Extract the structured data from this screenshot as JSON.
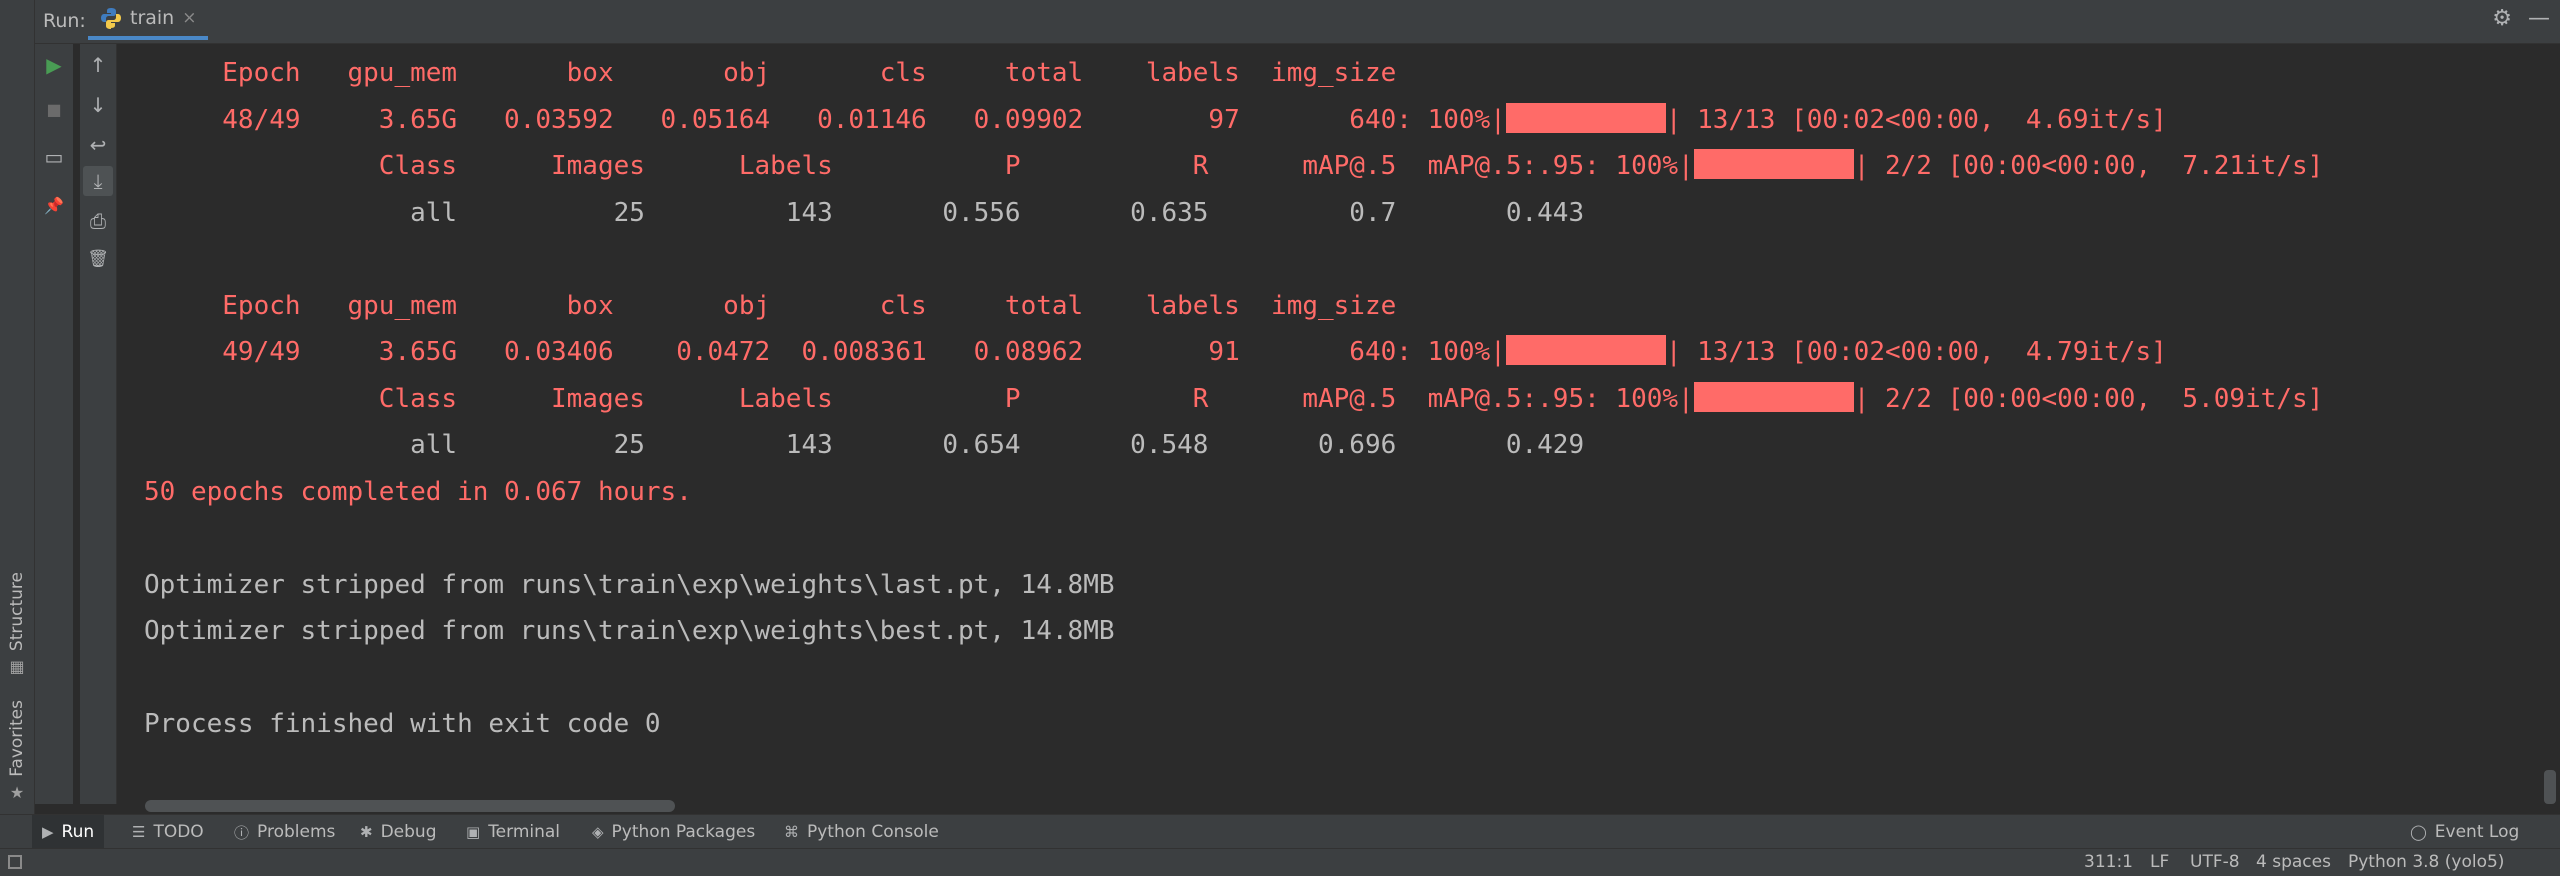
{
  "header": {
    "run_label": "Run:",
    "tab_title": "train",
    "tab_close": "×",
    "settings_glyph": "⚙",
    "minimize_glyph": "—"
  },
  "side": {
    "structure_label": "Structure",
    "favorites_label": "Favorites",
    "structure_glyph": "▦",
    "favorites_glyph": "★"
  },
  "toolbar1": {
    "run_glyph": "▶",
    "stop_glyph": "■",
    "layout_glyph": "▭",
    "pin_glyph": "📌"
  },
  "toolbar2": {
    "up_glyph": "↑",
    "down_glyph": "↓",
    "wrap_glyph": "↩",
    "scroll_end_glyph": "⤓",
    "print_glyph": "⎙",
    "trash_glyph": "🗑"
  },
  "console": {
    "lines": [
      {
        "cls": "red",
        "text": "     Epoch   gpu_mem       box       obj       cls     total    labels  img_size"
      },
      {
        "cls": "red",
        "text": "     48/49     3.65G   0.03592   0.05164   0.01146   0.09902        97       640: 100%|",
        "bar": true,
        "suffix": "| 13/13 [00:02<00:00,  4.69it/s]"
      },
      {
        "cls": "red",
        "text": "               Class      Images      Labels           P           R      mAP@.5  mAP@.5:.95: 100%|",
        "bar": true,
        "suffix": "| 2/2 [00:00<00:00,  7.21it/s]"
      },
      {
        "cls": "gray",
        "text": "                 all          25         143       0.556       0.635         0.7       0.443"
      },
      {
        "cls": "gray",
        "text": ""
      },
      {
        "cls": "red",
        "text": "     Epoch   gpu_mem       box       obj       cls     total    labels  img_size"
      },
      {
        "cls": "red",
        "text": "     49/49     3.65G   0.03406    0.0472  0.008361   0.08962        91       640: 100%|",
        "bar": true,
        "suffix": "| 13/13 [00:02<00:00,  4.79it/s]"
      },
      {
        "cls": "red",
        "text": "               Class      Images      Labels           P           R      mAP@.5  mAP@.5:.95: 100%|",
        "bar": true,
        "suffix": "| 2/2 [00:00<00:00,  5.09it/s]"
      },
      {
        "cls": "gray",
        "text": "                 all          25         143       0.654       0.548       0.696       0.429"
      },
      {
        "cls": "red",
        "text": "50 epochs completed in 0.067 hours."
      },
      {
        "cls": "gray",
        "text": ""
      },
      {
        "cls": "gray",
        "text": "Optimizer stripped from runs\\train\\exp\\weights\\last.pt, 14.8MB"
      },
      {
        "cls": "gray",
        "text": "Optimizer stripped from runs\\train\\exp\\weights\\best.pt, 14.8MB"
      },
      {
        "cls": "gray",
        "text": ""
      },
      {
        "cls": "gray",
        "text": "Process finished with exit code 0"
      }
    ]
  },
  "bottom_tabs": [
    {
      "id": "run",
      "icon": "▶",
      "label": "Run",
      "active": true
    },
    {
      "id": "todo",
      "icon": "☰",
      "label": "TODO",
      "active": false
    },
    {
      "id": "problems",
      "icon": "ⓘ",
      "label": "Problems",
      "active": false
    },
    {
      "id": "debug",
      "icon": "✱",
      "label": "Debug",
      "active": false
    },
    {
      "id": "terminal",
      "icon": "▣",
      "label": "Terminal",
      "active": false
    },
    {
      "id": "python-packages",
      "icon": "◈",
      "label": "Python Packages",
      "active": false
    },
    {
      "id": "python-console",
      "icon": "⌘",
      "label": "Python Console",
      "active": false
    }
  ],
  "event_log": {
    "icon": "◯",
    "label": "Event Log"
  },
  "status": {
    "position": "311:1",
    "line_sep": "LF",
    "encoding": "UTF-8",
    "indent": "4 spaces",
    "interpreter": "Python 3.8 (yolo5)"
  }
}
